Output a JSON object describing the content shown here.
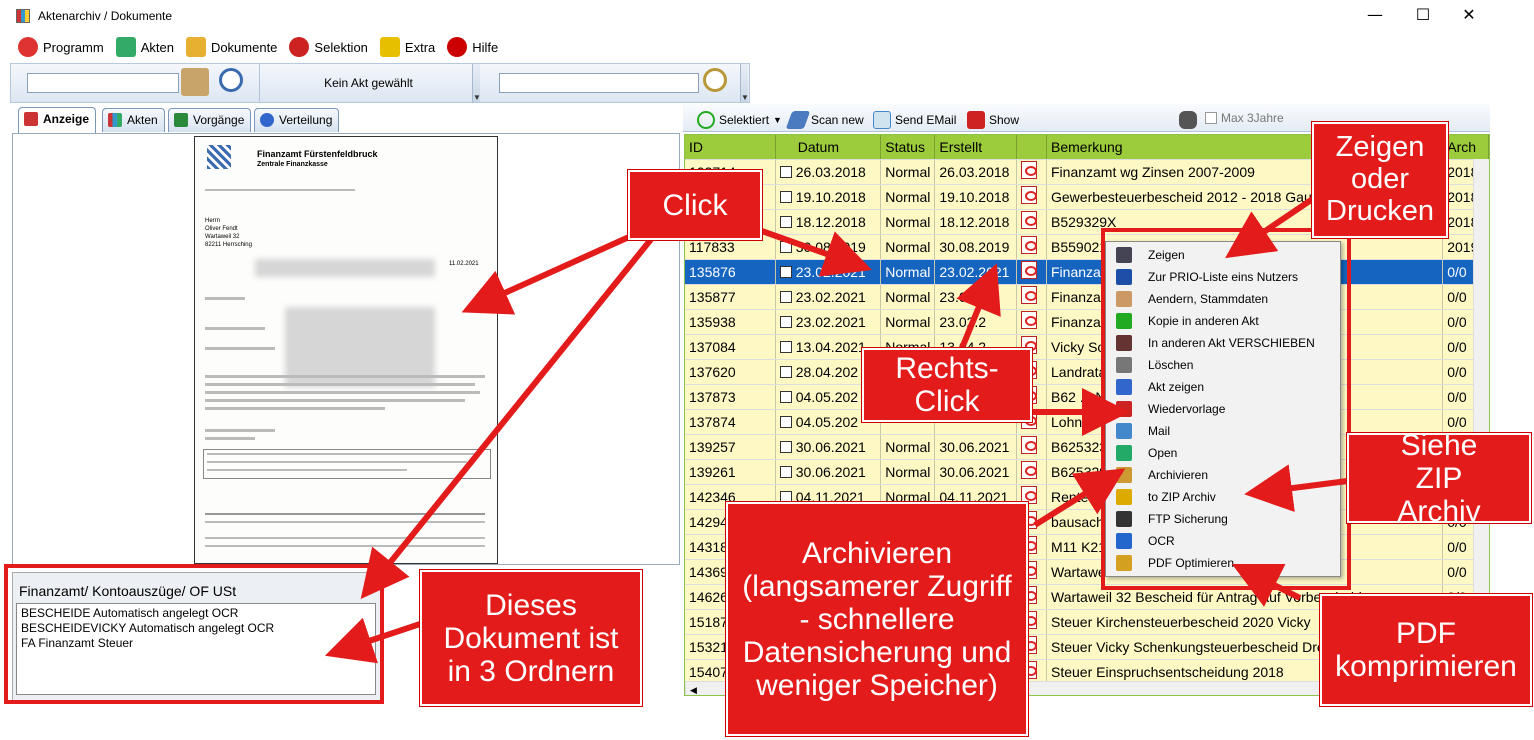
{
  "window": {
    "title": "Aktenarchiv / Dokumente",
    "minimize": "—",
    "maximize": "☐",
    "close": "✕"
  },
  "menu": [
    {
      "label": "Programm",
      "color": "#d33"
    },
    {
      "label": "Akten",
      "color": "#3a6"
    },
    {
      "label": "Dokumente",
      "color": "#e8b030"
    },
    {
      "label": "Selektion",
      "color": "#c22"
    },
    {
      "label": "Extra",
      "color": "#e6c000"
    },
    {
      "label": "Hilfe",
      "color": "#c00"
    }
  ],
  "toolbar": {
    "akt_status": "Kein Akt gewählt",
    "search1_value": "",
    "search2_value": ""
  },
  "tabs": [
    "Anzeige",
    "Akten",
    "Vorgänge",
    "Verteilung"
  ],
  "document_preview": {
    "header1": "Finanzamt Fürstenfeldbruck",
    "header2": "Zentrale Finanzkasse",
    "address": "Herrn\nOliver Fendt\nWartaweil 32\n82211 Herrsching",
    "date": "11.02.2021"
  },
  "folder_panel": {
    "title": "Finanzamt/ Kontoauszüge/ OF USt",
    "lines": [
      "BESCHEIDE Automatisch angelegt OCR",
      "BESCHEIDEVICKY Automatisch angelegt OCR",
      "FA Finanzamt Steuer"
    ]
  },
  "right_toolbar": {
    "selected": "Selektiert",
    "scan": "Scan new",
    "email": "Send EMail",
    "show": "Show",
    "max3": "Max 3Jahre"
  },
  "grid": {
    "columns": [
      "ID",
      "Datum",
      "Status",
      "Erstellt",
      "",
      "Bemerkung",
      "Arch"
    ],
    "rows": [
      [
        "103714",
        "26.03.2018",
        "Normal",
        "26.03.2018",
        "Finanzamt wg Zinsen 2007-2009",
        "2018"
      ],
      [
        "",
        "19.10.2018",
        "Normal",
        "19.10.2018",
        "Gewerbesteuerbescheid 2012 - 2018 Gauting",
        "2018"
      ],
      [
        "",
        "18.12.2018",
        "Normal",
        "18.12.2018",
        "B529329X",
        "2018"
      ],
      [
        "117833",
        "30.08.2019",
        "Normal",
        "30.08.2019",
        "B5590212 ... München Kto2...",
        "2019"
      ],
      [
        "135876",
        "23.02.2021",
        "Normal",
        "23.02.2021",
        "Finanzamt/",
        "0/0"
      ],
      [
        "135877",
        "23.02.2021",
        "Normal",
        "23.02.2",
        "Finanzamt/",
        "0/0"
      ],
      [
        "135938",
        "23.02.2021",
        "Normal",
        "23.02.2",
        "Finanzamt",
        "0/0"
      ],
      [
        "137084",
        "13.04.2021",
        "Normal",
        "13.04.2",
        "Vicky Soza",
        "0/0"
      ],
      [
        "137620",
        "28.04.202",
        "",
        "",
        "Landratant",
        "0/0"
      ],
      [
        "137873",
        "04.05.202",
        "",
        "",
        "B62 ... NBERG",
        "0/0"
      ],
      [
        "137874",
        "04.05.202",
        "",
        "",
        "Lohnsteue",
        "0/0"
      ],
      [
        "139257",
        "30.06.2021",
        "Normal",
        "30.06.2021",
        "B6253232",
        "0/0"
      ],
      [
        "139261",
        "30.06.2021",
        "Normal",
        "30.06.2021",
        "B6253297",
        "0/0"
      ],
      [
        "142346",
        "04.11.2021",
        "Normal",
        "04.11.2021",
        "Rente",
        "0/0"
      ],
      [
        "14294",
        "",
        "",
        "",
        "bausache",
        "0/0"
      ],
      [
        "14318",
        "",
        "",
        "",
        "M11 K21",
        "0/0"
      ],
      [
        "14369",
        "",
        "",
        "",
        "Wartawei ... STA 18.11....",
        "0/0"
      ],
      [
        "14626",
        "",
        "",
        "",
        "Wartaweil 32 Bescheid für Antrag auf Vorbescheid",
        "0/0"
      ],
      [
        "15187",
        "",
        "",
        "",
        "Steuer Kirchensteuerbescheid 2020 Vicky",
        "0/0"
      ],
      [
        "15321",
        "",
        "",
        "",
        "Steuer Vicky Schenkungsteuerbescheid Dresden",
        "0/0"
      ],
      [
        "15407",
        "",
        "",
        "",
        "Steuer Einspruchsentscheidung 2018",
        "0/0"
      ]
    ],
    "selected_row": 4
  },
  "context_menu": [
    {
      "label": "Zeigen",
      "color": "#445"
    },
    {
      "label": "Zur PRIO-Liste eins Nutzers",
      "color": "#1d4fa8"
    },
    {
      "label": "Aendern, Stammdaten",
      "color": "#c96"
    },
    {
      "label": "Kopie in anderen Akt",
      "color": "#2a2"
    },
    {
      "label": "In anderen Akt VERSCHIEBEN",
      "color": "#633"
    },
    {
      "label": "Löschen",
      "color": "#777"
    },
    {
      "label": "Akt zeigen",
      "color": "#36c"
    },
    {
      "label": "Wiedervorlage",
      "color": "#c22"
    },
    {
      "label": "Mail",
      "color": "#48c"
    },
    {
      "label": "Open",
      "color": "#2a6"
    },
    {
      "label": "Archivieren",
      "color": "#c93"
    },
    {
      "label": "to ZIP Archiv",
      "color": "#da0"
    },
    {
      "label": "FTP Sicherung",
      "color": "#333"
    },
    {
      "label": "OCR",
      "color": "#2366cc"
    },
    {
      "label": "PDF Optimieren",
      "color": "#d4a020"
    }
  ],
  "callouts": {
    "click": "Click",
    "zeigen": "Zeigen oder Drucken",
    "rechts": "Rechts-Click",
    "zip": "Siehe ZIP Archiv",
    "archiv": "Archivieren (langsamerer Zugriff - schnellere Datensicherung und weniger Speicher)",
    "dokument": "Dieses Dokument ist in 3 Ordnern",
    "pdf": "PDF komprimieren"
  },
  "colors": {
    "accent_red": "#e31b1b",
    "grid_header": "#9ccc3c",
    "row_bg": "#fdf8c4",
    "selected": "#1565c0"
  }
}
